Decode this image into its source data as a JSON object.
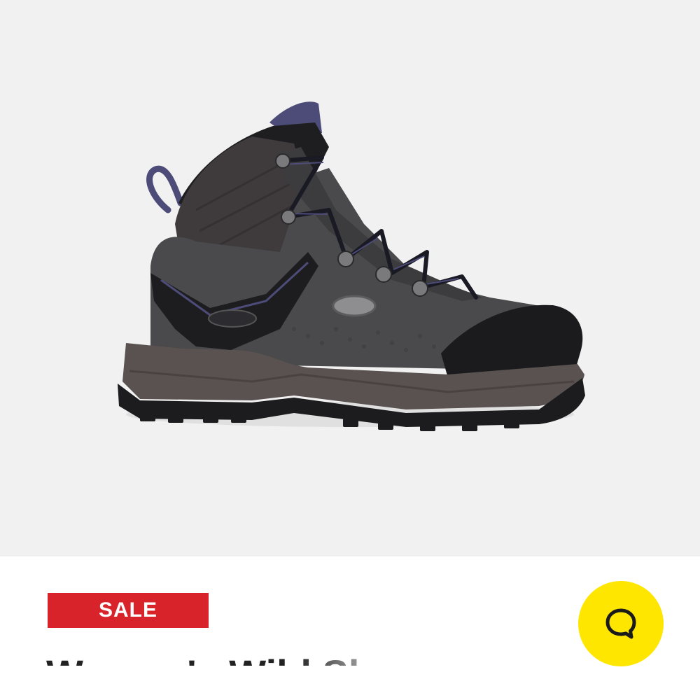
{
  "product": {
    "image_label": "boot-product-photo",
    "sale_label": "SALE",
    "title": "Women's Wild Sky"
  },
  "chat": {
    "icon": "chat-bubble-icon"
  },
  "colors": {
    "hero_background": "#f1f1f1",
    "sale_red": "#d8232a",
    "chat_yellow": "#ffe600",
    "boot_upper": "#4a4a4c",
    "boot_accent": "#4d4c78",
    "boot_midsole": "#5a5250",
    "boot_outsole": "#1c1c1e"
  }
}
